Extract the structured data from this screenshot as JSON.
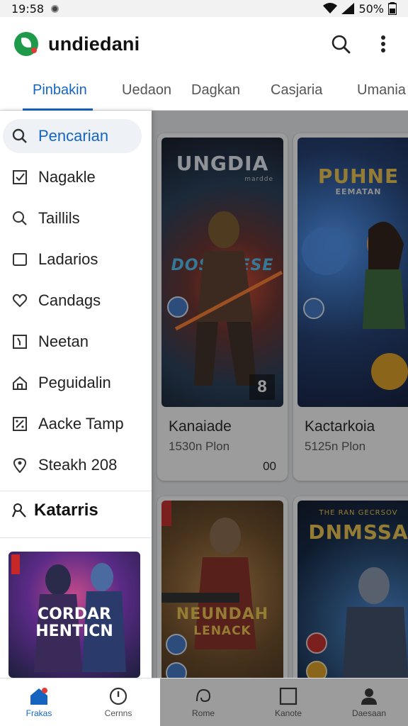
{
  "status_bar": {
    "time": "19:58",
    "battery": "50%"
  },
  "app_bar": {
    "title": "undiedani",
    "search_icon": "search-icon",
    "more_icon": "more-vert-icon"
  },
  "tabs": [
    {
      "label": "Pinbakin",
      "active": true
    },
    {
      "label": "Uedaon",
      "active": false
    },
    {
      "label": "Dagkan",
      "active": false
    },
    {
      "label": "Casjaria",
      "active": false
    },
    {
      "label": "Umania",
      "active": false
    }
  ],
  "drawer": {
    "items": [
      {
        "label": "Pencarian",
        "icon": "search-icon",
        "active": true
      },
      {
        "label": "Nagakle",
        "icon": "checkbox-icon"
      },
      {
        "label": "Taillils",
        "icon": "search-icon"
      },
      {
        "label": "Ladarios",
        "icon": "square-icon"
      },
      {
        "label": "Candags",
        "icon": "heart-icon"
      },
      {
        "label": "Neetan",
        "icon": "clock-square-icon"
      },
      {
        "label": "Peguidalin",
        "icon": "home-icon"
      },
      {
        "label": "Aacke Tamp",
        "icon": "percent-square-icon"
      },
      {
        "label": "Steakh 208",
        "icon": "location-icon"
      }
    ],
    "section_title": "Katarris",
    "section_icon": "person-icon",
    "banner": {
      "title_line1": "CORDAR",
      "title_line2": "HENTICN",
      "colors": [
        "#5a2a86",
        "#c24a8a",
        "#1c1f3c"
      ]
    }
  },
  "cards": [
    {
      "art_title": "UNGDIA",
      "art_subtitle": "DOSCMESE",
      "art_caption": "mardde",
      "badge": "8",
      "name": "Kanaiade",
      "price": "1530n Plon",
      "extra": "00",
      "colors": [
        "#213a56",
        "#6a2e2a",
        "#0e1320"
      ]
    },
    {
      "art_title": "PUHNE",
      "art_subtitle": "EEMATAN",
      "name": "Kactarkoia",
      "price": "5125n Plon",
      "extra": "",
      "colors": [
        "#1c3a70",
        "#3a7ad0",
        "#0b1636"
      ]
    },
    {
      "art_title": "",
      "art_subtitle": "NEUNDAH",
      "art_caption": "LENACK",
      "name": "",
      "price": "",
      "extra": "",
      "colors": [
        "#6d4a24",
        "#b8793a",
        "#2a1d12"
      ]
    },
    {
      "art_title": "DNMSSA",
      "art_subtitle": "",
      "art_caption": "THE RAN GECRSOV",
      "name": "",
      "price": "",
      "extra": "",
      "colors": [
        "#0c2140",
        "#2a5a8e",
        "#0a1224"
      ]
    }
  ],
  "bottom_nav": [
    {
      "label": "Frakas",
      "icon": "home-icon",
      "active": true
    },
    {
      "label": "Cernns",
      "icon": "clock-icon",
      "active": false
    },
    {
      "label": "Rome",
      "icon": "swirl-icon",
      "active": false
    },
    {
      "label": "Kanote",
      "icon": "square-icon",
      "active": false
    },
    {
      "label": "Daesaan",
      "icon": "person-icon",
      "active": false
    }
  ],
  "colors": {
    "accent": "#1565c0",
    "logo": "#1f9a4a",
    "scrim": "rgba(20,20,20,0.42)"
  }
}
